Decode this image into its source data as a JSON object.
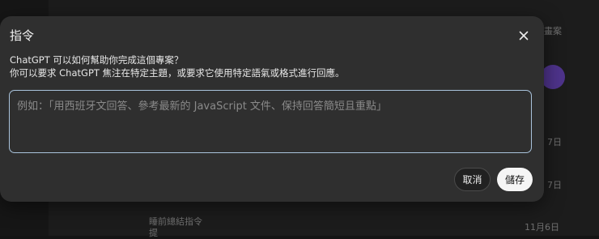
{
  "background": {
    "fragments": [
      "畫案",
      "7日",
      "7日",
      "睡前總結指令",
      "11月6日",
      "提"
    ]
  },
  "dialog": {
    "title": "指令",
    "description_line1": "ChatGPT 可以如何幫助你完成這個專案？",
    "description_line2": "你可以要求 ChatGPT 焦注在特定主題，或要求它使用特定語氣或格式進行回應。",
    "textarea": {
      "value": "",
      "placeholder": "例如：「用西班牙文回答、參考最新的 JavaScript 文件、保持回答簡短且重點」"
    },
    "cancel_label": "取消",
    "save_label": "儲存"
  },
  "colors": {
    "modal_bg": "#2f2f2f",
    "focus_border": "#a9c3dc",
    "save_bg": "#f5f5f5"
  }
}
